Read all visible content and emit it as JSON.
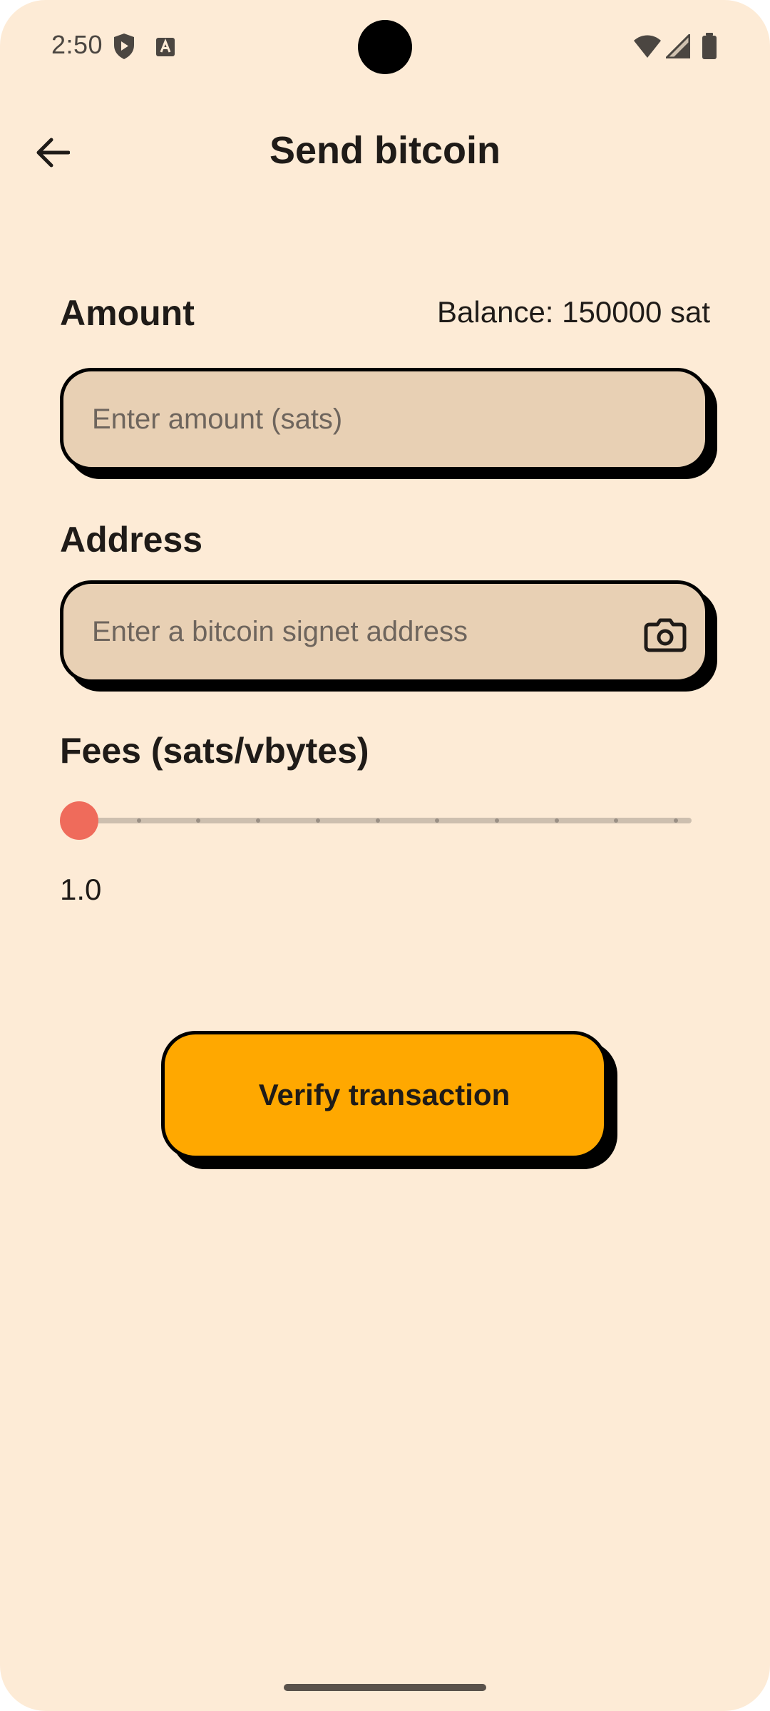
{
  "status_bar": {
    "time": "2:50",
    "icons": [
      "shield-play-icon",
      "font-a-icon",
      "wifi-icon",
      "cell-signal-icon",
      "battery-icon"
    ]
  },
  "header": {
    "back_icon": "arrow-back-icon",
    "title": "Send bitcoin"
  },
  "amount": {
    "label": "Amount",
    "balance": "Balance: 150000 sat",
    "placeholder": "Enter amount (sats)",
    "value": ""
  },
  "address": {
    "label": "Address",
    "placeholder": "Enter a bitcoin signet address",
    "value": "",
    "scan_icon": "camera-icon"
  },
  "fees": {
    "label": "Fees (sats/vbytes)",
    "value_text": "1.0",
    "slider_fraction": 0,
    "tick_count": 11
  },
  "actions": {
    "verify_label": "Verify transaction"
  },
  "colors": {
    "background": "#FDEBD6",
    "field_fill": "#E8D0B4",
    "accent_button": "#FFA800",
    "slider_thumb": "#EF6B5B",
    "slider_track": "#CDBFAF"
  }
}
